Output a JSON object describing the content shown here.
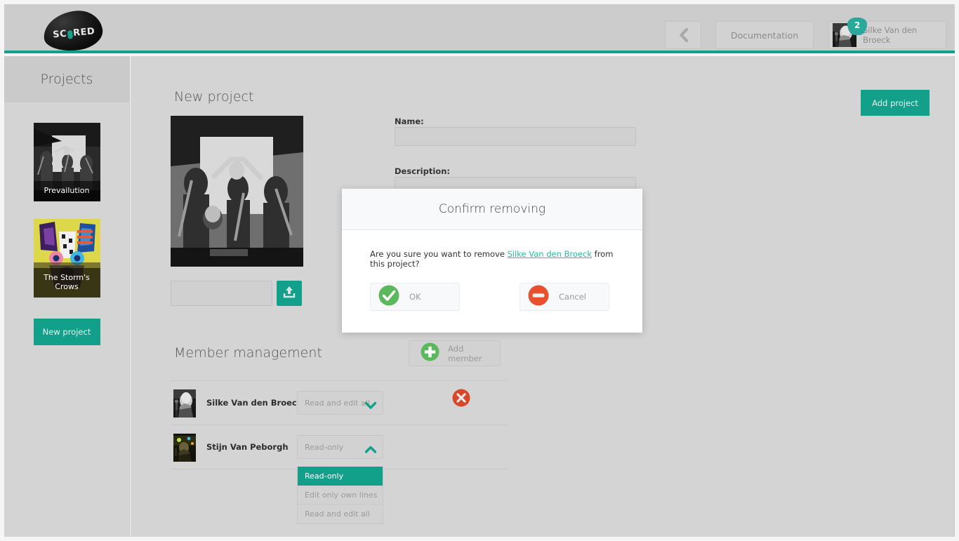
{
  "app": {
    "logo_text_left": "SC",
    "logo_text_right": "RED"
  },
  "topbar": {
    "back_icon": "chevron-left-icon",
    "documentation_label": "Documentation",
    "user_name": "Silke Van den Broeck",
    "notification_count": "2"
  },
  "sidebar": {
    "title": "Projects",
    "projects": [
      {
        "label": "Prevailution"
      },
      {
        "label": "The Storm's Crows"
      }
    ],
    "new_project_label": "New project"
  },
  "main": {
    "page_title": "New project",
    "add_project_label": "Add project",
    "upload_filename_value": "",
    "upload_icon": "upload-icon",
    "fields": [
      {
        "label": "Name:",
        "value": ""
      },
      {
        "label": "Description:",
        "value": ""
      }
    ],
    "member_section": {
      "title": "Member management",
      "add_member_label": "Add member",
      "members": [
        {
          "name": "Silke Van den Broeck (me)",
          "permission": "Read and edit all",
          "caret": "chevron-down-icon",
          "removable": true
        },
        {
          "name": "Stijn Van Peborgh",
          "permission": "Read-only",
          "caret": "chevron-up-icon",
          "removable": false
        }
      ],
      "permission_options": [
        {
          "label": "Read-only",
          "selected": true
        },
        {
          "label": "Edit only own lines",
          "selected": false
        },
        {
          "label": "Read and edit all",
          "selected": false
        }
      ]
    }
  },
  "modal": {
    "title": "Confirm removing",
    "text_before": "Are you sure you want to remove ",
    "link_text": "Silke Van den Broeck",
    "text_after": " from this project?",
    "ok_label": "OK",
    "cancel_label": "Cancel"
  },
  "colors": {
    "accent_teal": "#12a08a",
    "link_teal": "#2fb9a4",
    "danger_red": "#d9472b",
    "success_green": "#5cb85c",
    "page_bg": "#d4d4d4",
    "topbar_bg": "#cccccc"
  }
}
